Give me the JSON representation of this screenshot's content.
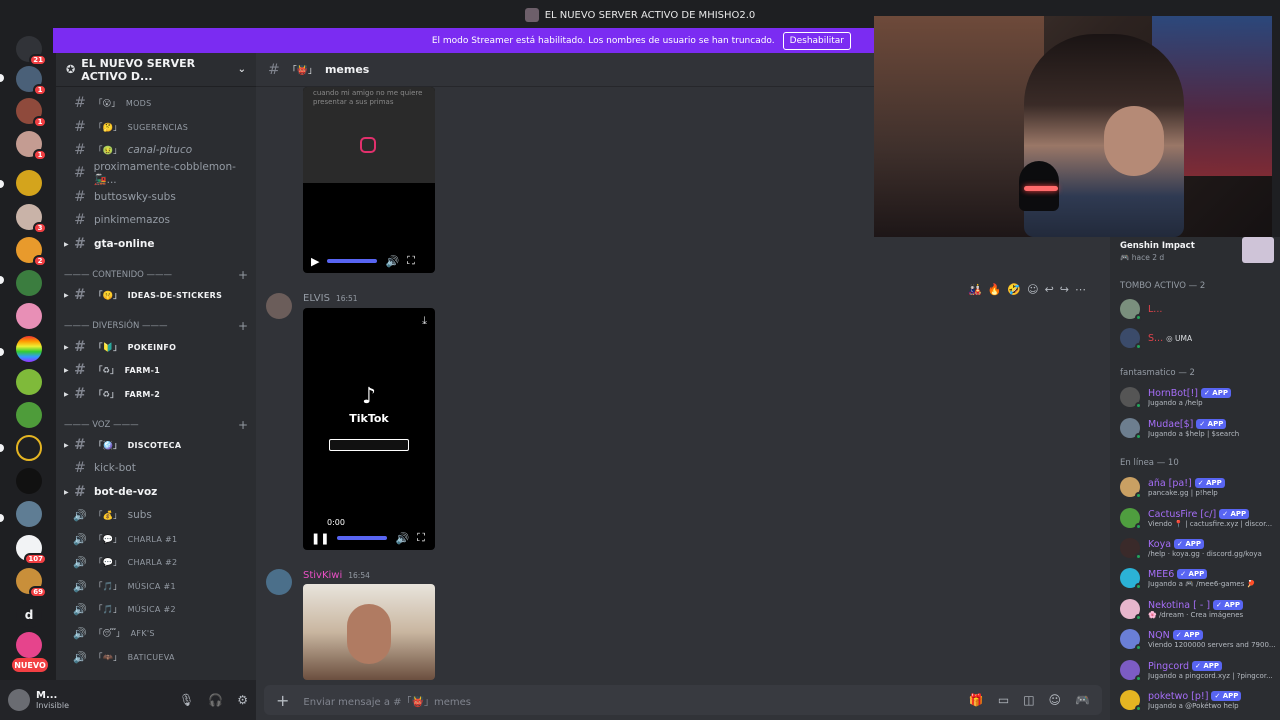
{
  "window": {
    "title": "EL NUEVO SERVER ACTIVO DE MHISHO2.0"
  },
  "banner": {
    "text": "El modo Streamer está habilitado. Los nombres de usuario se han truncado.",
    "button": "Deshabilitar"
  },
  "rail": {
    "badges": {
      "b1": "21",
      "b2": "1",
      "b3": "1",
      "b4": "1",
      "b5": "3",
      "b6": "2",
      "b7": "107",
      "b8": "69"
    },
    "letter": "d",
    "nuevo": "NUEVO"
  },
  "server": {
    "name": "EL NUEVO SERVER ACTIVO D..."
  },
  "channels": {
    "c1": "MODS",
    "c2": "SUGERENCIAS",
    "c3": "canal-pituco",
    "c4": "proximamente-cobblemon-🚂...",
    "c5": "buttoswky-subs",
    "c6": "pinkimemazos",
    "c7": "gta-online",
    "cat1": "——— CONTENIDO ———",
    "c8": "IDEAS-DE-STICKERS",
    "cat2": "——— DIVERSIÓN ———",
    "c9": "POKEINFO",
    "c10": "FARM-1",
    "c11": "FARM-2",
    "cat3": "——— VOZ ———",
    "c12": "DISCOTECA",
    "c13": "kick-bot",
    "c14": "bot-de-voz",
    "c15": "subs",
    "c16": "CHARLA #1",
    "c17": "CHARLA #2",
    "c18": "MÚSICA #1",
    "c19": "MÚSICA #2",
    "c20": "AFK'S",
    "c21": "BATICUEVA"
  },
  "user": {
    "name": "M...",
    "status": "Invisible"
  },
  "chat": {
    "channel": "memes",
    "messages": [
      {
        "author": "ELVIS",
        "time": "16:51",
        "color": "#949ba4"
      },
      {
        "author": "StivKiwi",
        "time": "16:54",
        "color": "#e94fc5"
      }
    ],
    "video1": {
      "overlay_text": "cuando mi amigo no me quiere presentar a sus primas"
    },
    "video2": {
      "brand": "TikTok",
      "time": "0:00"
    },
    "composer_placeholder": "Enviar mensaje a #「👹」memes"
  },
  "members": {
    "activity": {
      "title": "Genshin Impact",
      "sub": "🎮 hace 2 d"
    },
    "groups": {
      "g1": "TOMBO ACTIVO — 2",
      "g2": "fantasmatico — 2",
      "g3": "En línea — 10"
    },
    "list": [
      {
        "name": "L...",
        "status": "",
        "app": false,
        "red": true,
        "tag": ""
      },
      {
        "name": "S...",
        "status": "",
        "app": false,
        "red": true,
        "tag": "UMA"
      },
      {
        "name": "HornBot[!]",
        "status": "Jugando a /help",
        "app": true
      },
      {
        "name": "Mudae[$]",
        "status": "Jugando a $help | $search",
        "app": true
      },
      {
        "name": "aña [pa!]",
        "status": "pancake.gg | p!help",
        "app": true
      },
      {
        "name": "CactusFire [c/]",
        "status": "Viendo 📍 | cactusfire.xyz | discor...",
        "app": true
      },
      {
        "name": "Koya",
        "status": "/help · koya.gg · discord.gg/koya",
        "app": true
      },
      {
        "name": "MEE6",
        "status": "Jugando a 🎮 /mee6-games 🏓",
        "app": true
      },
      {
        "name": "Nekotina [ - ]",
        "status": "🌸 /dream · Crea imágenes",
        "app": true
      },
      {
        "name": "NQN",
        "status": "Viendo 1200000 servers and 7900...",
        "app": true
      },
      {
        "name": "Pingcord",
        "status": "Jugando a pingcord.xyz | ?pingcor...",
        "app": true
      },
      {
        "name": "poketwo [p!]",
        "status": "Jugando a @Pokétwo help",
        "app": true
      }
    ],
    "app_label": "✓ APP"
  }
}
